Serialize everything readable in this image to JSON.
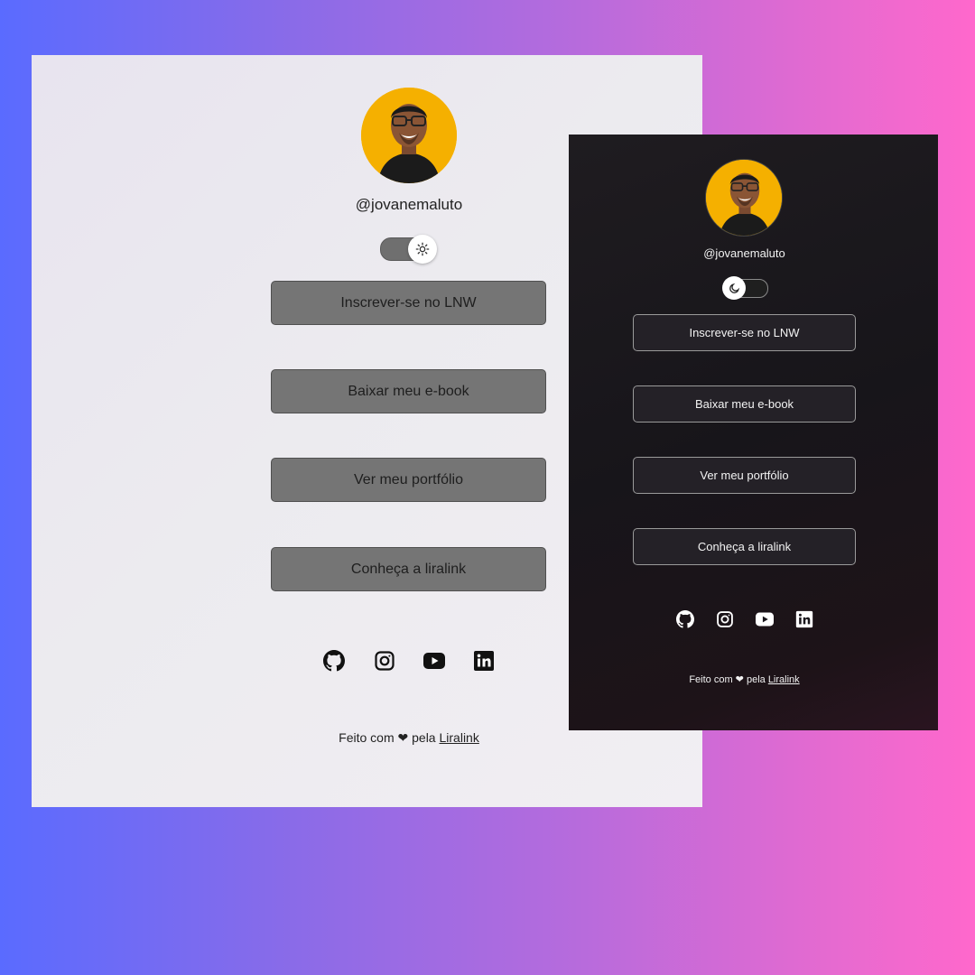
{
  "light": {
    "username": "@jovanemaluto",
    "buttons": [
      {
        "label": "Inscrever-se no LNW"
      },
      {
        "label": "Baixar meu e-book"
      },
      {
        "label": "Ver meu portfólio"
      },
      {
        "label": "Conheça a liralink"
      }
    ],
    "socials": [
      {
        "icon": "github-icon"
      },
      {
        "icon": "instagram-icon"
      },
      {
        "icon": "youtube-icon"
      },
      {
        "icon": "linkedin-icon"
      }
    ],
    "footer": {
      "prefix": "Feito com",
      "heart": "❤",
      "middle": "pela",
      "link": "Liralink"
    },
    "theme_toggle_icon": "sun-icon"
  },
  "dark": {
    "username": "@jovanemaluto",
    "buttons": [
      {
        "label": "Inscrever-se no LNW"
      },
      {
        "label": "Baixar meu e-book"
      },
      {
        "label": "Ver meu portfólio"
      },
      {
        "label": "Conheça a liralink"
      }
    ],
    "socials": [
      {
        "icon": "github-icon"
      },
      {
        "icon": "instagram-icon"
      },
      {
        "icon": "youtube-icon"
      },
      {
        "icon": "linkedin-icon"
      }
    ],
    "footer": {
      "prefix": "Feito com",
      "heart": "❤",
      "middle": "pela",
      "link": "Liralink"
    },
    "theme_toggle_icon": "moon-icon"
  },
  "colors": {
    "avatar_bg": "#f5b000",
    "light_button": "#757575",
    "dark_button": "#242127",
    "gradient_start": "#5a6bff",
    "gradient_end": "#ff68cc"
  }
}
